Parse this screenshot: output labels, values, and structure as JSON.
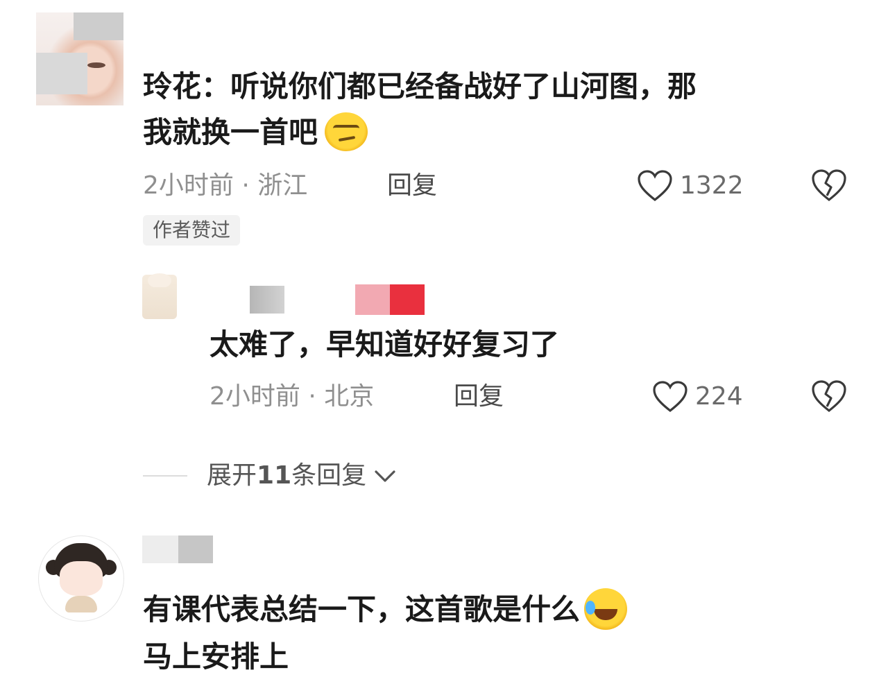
{
  "comments": [
    {
      "line1": "玲花：听说你们都已经备战好了山河图，那",
      "line2": "我就换一首吧",
      "emoji": "smirk-emoji",
      "meta": "2小时前 · 浙江",
      "reply_label": "回复",
      "likes": "1322",
      "badge": "作者赞过"
    },
    {
      "line1": "太难了，早知道好好复习了",
      "meta": "2小时前 · 北京",
      "reply_label": "回复",
      "likes": "224"
    },
    {
      "line1": "有课代表总结一下，这首歌是什么",
      "line2": "马上安排上",
      "emoji": "laugh-emoji"
    }
  ],
  "expand": {
    "prefix": "展开",
    "count": "11",
    "suffix": "条回复"
  },
  "icons": {
    "like": "heart-outline-icon",
    "dislike": "broken-heart-icon",
    "expand": "chevron-down-icon"
  },
  "colors": {
    "text_primary": "#1a1a1a",
    "text_meta": "#8f8f8f",
    "badge_bg": "#f2f2f2"
  }
}
